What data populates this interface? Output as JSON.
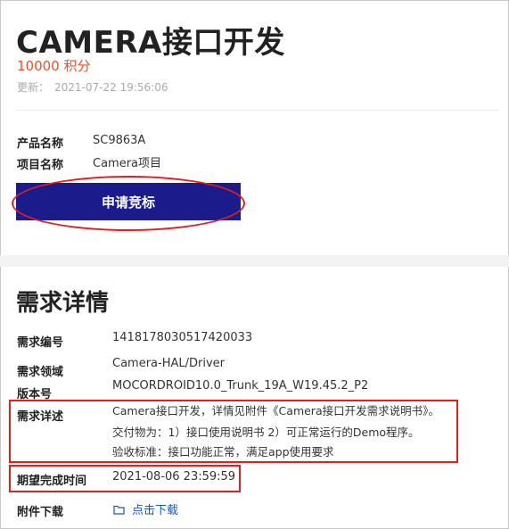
{
  "header": {
    "title": "CAMERA接口开发",
    "points": "10000 积分",
    "updated_label": "更新：",
    "updated_time": "2021-07-22 19:56:06"
  },
  "product": {
    "name_label": "产品名称",
    "name_value": "SC9863A",
    "project_label": "项目名称",
    "project_value": "Camera项目",
    "apply_button": "申请竞标"
  },
  "details": {
    "section_title": "需求详情",
    "id_label": "需求编号",
    "id_value": "1418178030517420033",
    "domain_label": "需求领域",
    "domain_value": "Camera-HAL/Driver",
    "version_label": "版本号",
    "version_value": "MOCORDROID10.0_Trunk_19A_W19.45.2_P2",
    "desc_label": "需求详述",
    "desc_lines": [
      "Camera接口开发，详情见附件《Camera接口开发需求说明书》。",
      "交付物为：1）接口使用说明书 2）可正常运行的Demo程序。",
      "验收标准：接口功能正常，满足app使用要求"
    ],
    "deadline_label": "期望完成时间",
    "deadline_value": "2021-08-06 23:59:59",
    "attachment_label": "附件下载",
    "attachment_link": "点击下载"
  },
  "colors": {
    "accent_orange": "#e8512a",
    "button_navy": "#1b1b8c",
    "highlight_red": "#e02020",
    "link_blue": "#1f56b0"
  },
  "icons": {
    "attachment": "folder-icon"
  }
}
